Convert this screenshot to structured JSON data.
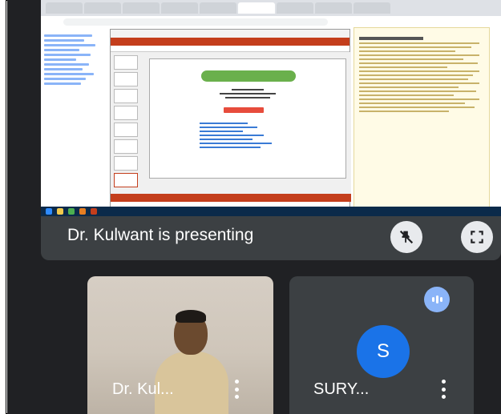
{
  "presenter_banner": {
    "text": "Dr. Kulwant is presenting"
  },
  "controls": {
    "unpin_icon": "unpin-icon",
    "fullscreen_icon": "fullscreen-icon"
  },
  "participants": [
    {
      "name": "Dr. Kul...",
      "type": "video"
    },
    {
      "name": "SURY...",
      "avatar_letter": "S",
      "type": "avatar",
      "speaking": true
    }
  ],
  "colors": {
    "meet_bg": "#202124",
    "tile_bg": "#3c4043",
    "avatar_bg": "#1a73e8",
    "audio_indicator": "#8ab4f8",
    "ppt_accent": "#c43e1c"
  }
}
